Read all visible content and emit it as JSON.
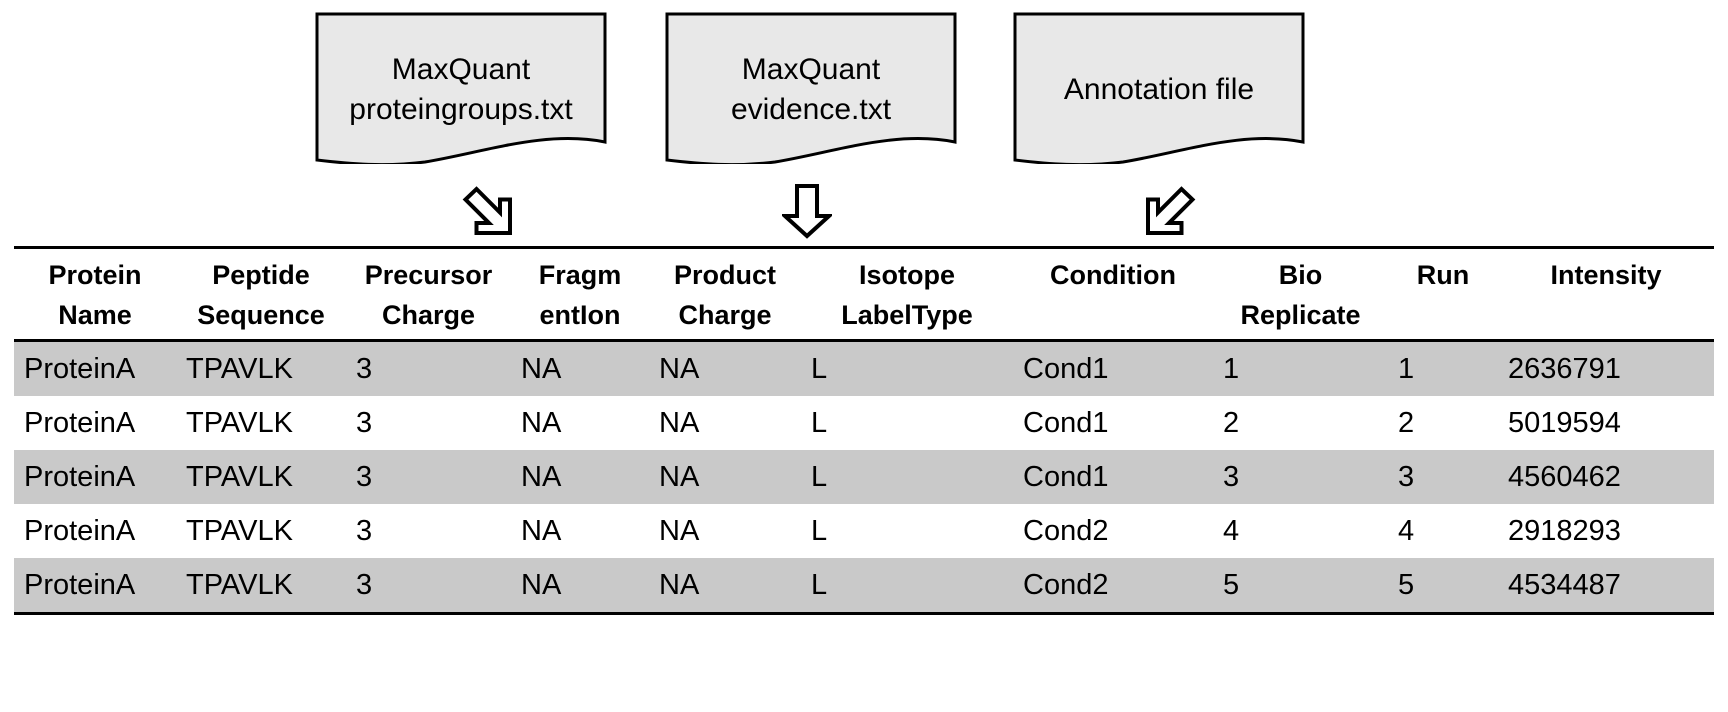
{
  "sources": [
    {
      "id": "maxquant-proteingroups",
      "line1": "MaxQuant",
      "line2": "proteingroups.txt",
      "arrow": "arrow-down-right"
    },
    {
      "id": "maxquant-evidence",
      "line1": "MaxQuant",
      "line2": "evidence.txt",
      "arrow": "arrow-down"
    },
    {
      "id": "annotation-file",
      "line1": "Annotation file",
      "line2": "",
      "arrow": "arrow-down-left"
    }
  ],
  "table": {
    "columns": [
      {
        "line1": "Protein",
        "line2": "Name"
      },
      {
        "line1": "Peptide",
        "line2": "Sequence"
      },
      {
        "line1": "Precursor",
        "line2": "Charge"
      },
      {
        "line1": "Fragm",
        "line2": "entIon"
      },
      {
        "line1": "Product",
        "line2": "Charge"
      },
      {
        "line1": "Isotope",
        "line2": "LabelType"
      },
      {
        "line1": "Condition",
        "line2": ""
      },
      {
        "line1": "Bio",
        "line2": "Replicate"
      },
      {
        "line1": "Run",
        "line2": ""
      },
      {
        "line1": "Intensity",
        "line2": ""
      }
    ],
    "rows": [
      [
        "ProteinA",
        "TPAVLK",
        "3",
        "NA",
        "NA",
        "L",
        "Cond1",
        "1",
        "1",
        "2636791"
      ],
      [
        "ProteinA",
        "TPAVLK",
        "3",
        "NA",
        "NA",
        "L",
        "Cond1",
        "2",
        "2",
        "5019594"
      ],
      [
        "ProteinA",
        "TPAVLK",
        "3",
        "NA",
        "NA",
        "L",
        "Cond1",
        "3",
        "3",
        "4560462"
      ],
      [
        "ProteinA",
        "TPAVLK",
        "3",
        "NA",
        "NA",
        "L",
        "Cond2",
        "4",
        "4",
        "2918293"
      ],
      [
        "ProteinA",
        "TPAVLK",
        "3",
        "NA",
        "NA",
        "L",
        "Cond2",
        "5",
        "5",
        "4534487"
      ]
    ]
  },
  "colors": {
    "shaded_row": "#c9c9c9",
    "document_fill": "#e8e8e8",
    "outline": "#000000"
  }
}
